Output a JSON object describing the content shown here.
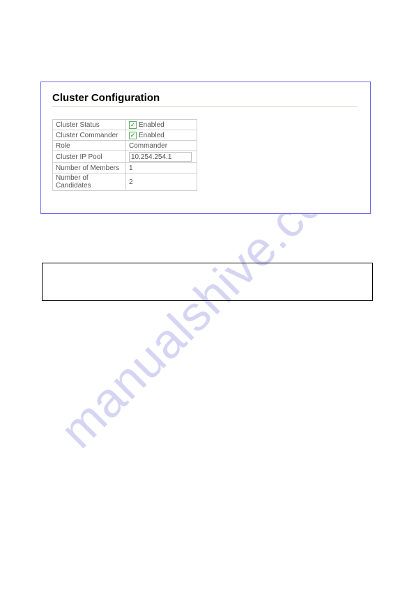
{
  "watermark": "manualshive.com",
  "panel": {
    "title": "Cluster Configuration",
    "rows": {
      "cluster_status": {
        "label": "Cluster Status",
        "enabled_text": "Enabled",
        "checked": true
      },
      "cluster_commander": {
        "label": "Cluster Commander",
        "enabled_text": "Enabled",
        "checked": true
      },
      "role": {
        "label": "Role",
        "value": "Commander"
      },
      "ip_pool": {
        "label": "Cluster IP Pool",
        "value": "10.254.254.1"
      },
      "num_members": {
        "label": "Number of Members",
        "value": "1"
      },
      "num_candidates": {
        "label": "Number of Candidates",
        "value": "2"
      }
    }
  }
}
